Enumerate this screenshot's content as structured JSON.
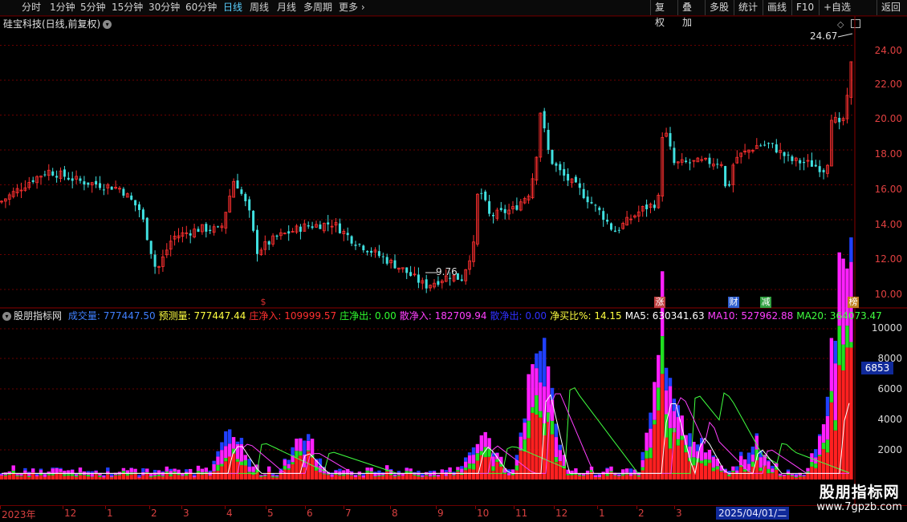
{
  "toolbar": {
    "periods": [
      "分时",
      "1分钟",
      "5分钟",
      "15分钟",
      "30分钟",
      "60分钟",
      "日线",
      "周线",
      "月线",
      "多周期",
      "更多"
    ],
    "active_period": "日线",
    "right_buttons": [
      "复权",
      "叠加",
      "多股",
      "统计",
      "画线",
      "F10",
      "+自选",
      "返回"
    ]
  },
  "stock": {
    "title": "硅宝科技(日线,前复权)"
  },
  "price_axis": {
    "labels": [
      "24.00",
      "22.00",
      "20.00",
      "18.00",
      "16.00",
      "14.00",
      "12.00",
      "10.00"
    ],
    "high_marker": "24.67",
    "low_marker": "9.76"
  },
  "event_markers": [
    {
      "label": "$",
      "color": "#e03030"
    },
    {
      "label": "涨",
      "color": "#c04040"
    },
    {
      "label": "财",
      "color": "#3060d0"
    },
    {
      "label": "减",
      "color": "#30a040"
    },
    {
      "label": "榜",
      "color": "#c08020"
    }
  ],
  "indicator": {
    "name": "股朋指标网",
    "items": [
      {
        "text": "成交量: 777447.50",
        "color": "#4080ff"
      },
      {
        "text": "预测量: 777447.44",
        "color": "#ffff40"
      },
      {
        "text": "庄净入: 109999.57",
        "color": "#ff3030"
      },
      {
        "text": "庄净出: 0.00",
        "color": "#30ff30"
      },
      {
        "text": "散净入: 182709.94",
        "color": "#ff40ff"
      },
      {
        "text": "散净出: 0.00",
        "color": "#3030ff"
      },
      {
        "text": "净买比%: 14.15",
        "color": "#ffff40"
      },
      {
        "text": "MA5: 630341.63",
        "color": "#ffffff"
      },
      {
        "text": "MA10: 527962.88",
        "color": "#ff40ff"
      },
      {
        "text": "MA20: 364073.47",
        "color": "#40ff40"
      }
    ]
  },
  "volume_axis": {
    "labels": [
      "10000",
      "8000",
      "6000",
      "4000",
      "2000"
    ],
    "cursor_value": "6853"
  },
  "date_axis": {
    "labels": [
      "2023年",
      "12",
      "1",
      "2",
      "3",
      "4",
      "5",
      "6",
      "7",
      "8",
      "9",
      "10",
      "11",
      "12",
      "1",
      "2",
      "3"
    ],
    "cursor_date": "2025/04/01/二"
  },
  "watermark": {
    "title": "股朋指标网",
    "url": "www.7gpzb.com"
  },
  "colors": {
    "up": "#ff3030",
    "down": "#40e0e0",
    "grid": "#6a0000"
  }
}
